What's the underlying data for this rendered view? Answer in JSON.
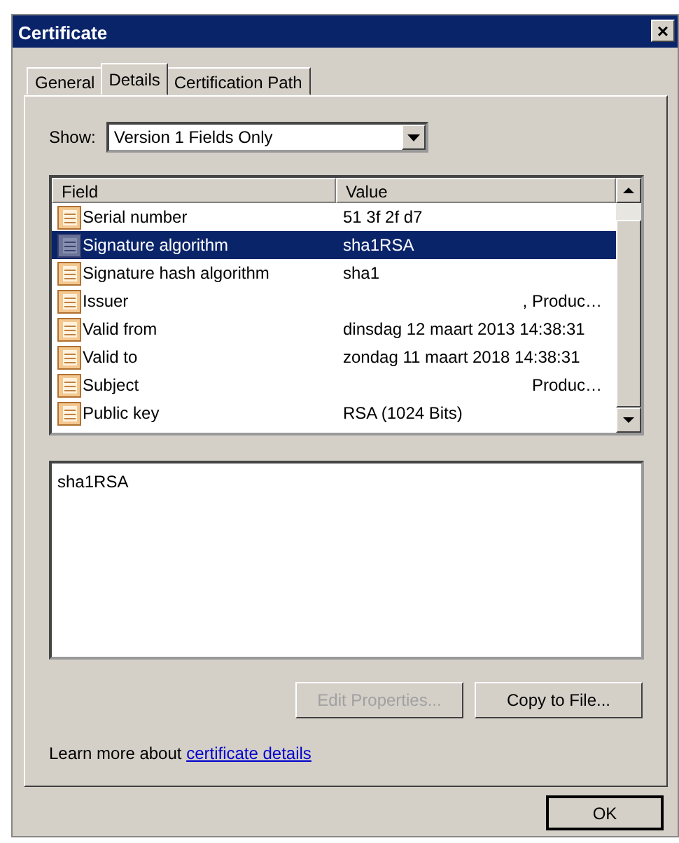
{
  "window": {
    "title": "Certificate",
    "close": "×"
  },
  "tabs": [
    {
      "label": "General",
      "selected": false
    },
    {
      "label": "Details",
      "selected": true
    },
    {
      "label": "Certification Path",
      "selected": false
    }
  ],
  "show": {
    "label": "Show:",
    "value": "Version 1 Fields Only"
  },
  "table": {
    "columns": [
      "Field",
      "Value"
    ],
    "rows": [
      {
        "field": "Serial number",
        "value": "51 3f 2f d7",
        "kind": "plain",
        "selected": false
      },
      {
        "field": "Signature algorithm",
        "value": "sha1RSA",
        "kind": "plain",
        "selected": true
      },
      {
        "field": "Signature hash algorithm",
        "value": "sha1",
        "kind": "plain",
        "selected": false
      },
      {
        "field": "Issuer",
        "value": ", Produc…",
        "kind": "elided",
        "selected": false
      },
      {
        "field": "Valid from",
        "value": "dinsdag 12 maart 2013 14:38:31",
        "kind": "plain",
        "selected": false
      },
      {
        "field": "Valid to",
        "value": "zondag 11 maart 2018 14:38:31",
        "kind": "plain",
        "selected": false
      },
      {
        "field": "Subject",
        "value": "Produc…",
        "kind": "elided",
        "selected": false
      },
      {
        "field": "Public key",
        "value": "RSA (1024 Bits)",
        "kind": "plain",
        "selected": false
      }
    ]
  },
  "detail_text": "sha1RSA",
  "buttons": [
    {
      "label": "Edit Properties...",
      "disabled": true
    },
    {
      "label": "Copy to File...",
      "disabled": false
    }
  ],
  "learn_more": {
    "text": "Learn more about",
    "link": "certificate details"
  },
  "ok_button": "OK"
}
